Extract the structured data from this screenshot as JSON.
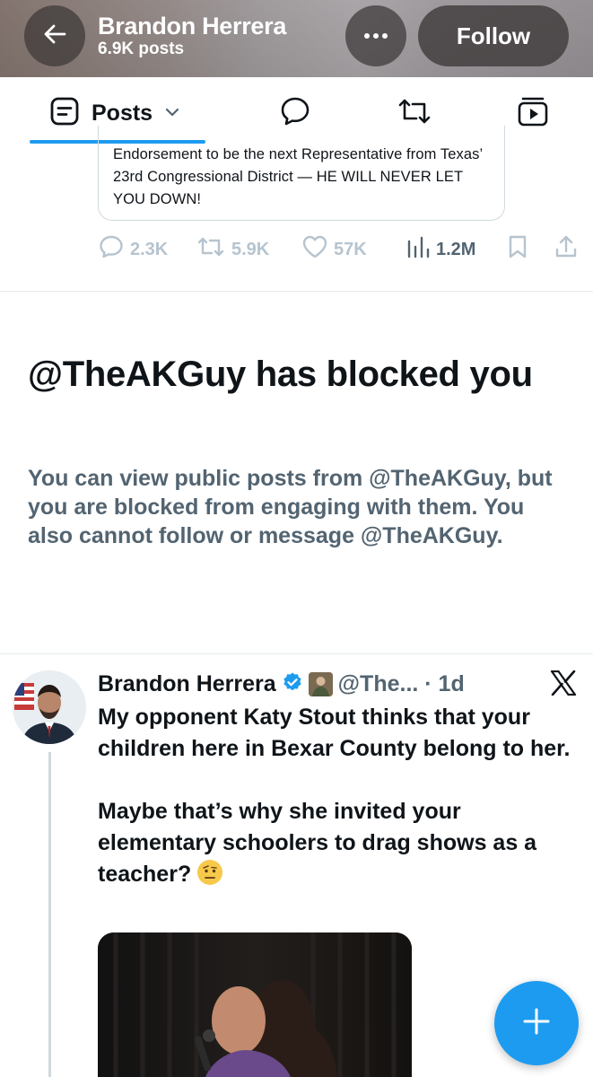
{
  "header": {
    "name": "Brandon Herrera",
    "post_count": "6.9K posts",
    "follow_label": "Follow",
    "back_icon": "arrow-left-icon",
    "more_icon": "more-dots-icon"
  },
  "tabs": {
    "posts_label": "Posts",
    "items": [
      "posts",
      "replies",
      "reposts",
      "videos"
    ]
  },
  "quoted_post": {
    "text": "Endorsement to be the next Representative from Texas’ 23rd Congressional District — HE WILL NEVER LET YOU DOWN!"
  },
  "action_bar": {
    "replies": "2.3K",
    "reposts": "5.9K",
    "likes": "57K",
    "views": "1.2M"
  },
  "blocked": {
    "title": "@TheAKGuy has blocked you",
    "description": "You can view public posts from @TheAKGuy, but you are blocked from engaging with them. You also cannot follow or message @TheAKGuy."
  },
  "tweet": {
    "name": "Brandon Herrera",
    "handle_time": "@The... · 1d",
    "paragraph1": "My opponent Katy Stout thinks that your children here in Bexar County belong to her.",
    "paragraph2": "Maybe that’s why she invited your elementary schoolers to drag shows as a teacher?"
  },
  "colors": {
    "accent": "#1d9bf0",
    "text": "#0f1419",
    "secondary": "#536471",
    "faded": "#b6c4cf"
  }
}
